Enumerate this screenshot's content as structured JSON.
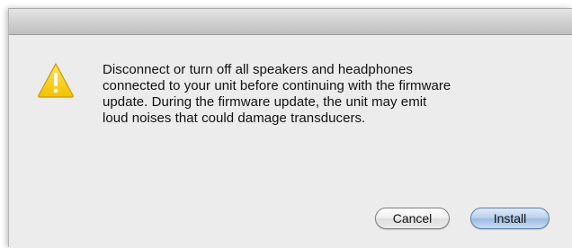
{
  "dialog": {
    "message_lines": [
      "Disconnect or turn off all speakers and headphones",
      "connected to your unit before continuing with the firmware",
      "update. During the firmware update, the unit may emit",
      "loud noises that could damage transducers."
    ],
    "icon": "warning-triangle-icon",
    "buttons": {
      "cancel_label": "Cancel",
      "install_label": "Install"
    }
  },
  "colors": {
    "warning_yellow": "#f5cf1f",
    "default_button_blue": "#9fbde4",
    "background": "#ececec"
  }
}
